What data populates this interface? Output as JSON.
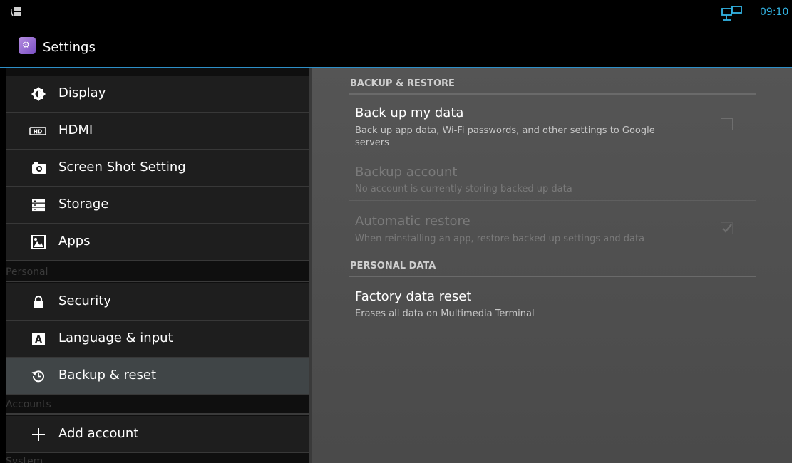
{
  "status_bar": {
    "time": "09:10",
    "left_icon": "call-forward-icon",
    "network_icon": "ethernet-monitor-icon"
  },
  "action_bar": {
    "title": "Settings",
    "icon": "settings-app-icon"
  },
  "sidebar": {
    "items": [
      {
        "label": "Display",
        "icon": "brightness-icon"
      },
      {
        "label": "HDMI",
        "icon": "hdmi-icon",
        "icon_text": "HD"
      },
      {
        "label": "Screen Shot Setting",
        "icon": "camera-icon"
      },
      {
        "label": "Storage",
        "icon": "storage-icon"
      },
      {
        "label": "Apps",
        "icon": "apps-icon"
      },
      {
        "label": "Security",
        "icon": "lock-icon"
      },
      {
        "label": "Language & input",
        "icon": "language-icon",
        "icon_text": "A"
      },
      {
        "label": "Backup & reset",
        "icon": "backup-icon",
        "selected": true
      },
      {
        "label": "Add account",
        "icon": "plus-icon"
      }
    ],
    "headers": [
      "Personal",
      "Accounts",
      "System"
    ]
  },
  "content": {
    "backup_section": "BACKUP & RESTORE",
    "backup_my_data": {
      "title": "Back up my data",
      "summary": "Back up app data, Wi-Fi passwords, and other settings to Google servers",
      "checked": false
    },
    "backup_account": {
      "title": "Backup account",
      "summary": "No account is currently storing backed up data"
    },
    "auto_restore": {
      "title": "Automatic restore",
      "summary": "When reinstalling an app, restore backed up settings and data",
      "checked": true
    },
    "personal_section": "PERSONAL DATA",
    "factory_reset": {
      "title": "Factory data reset",
      "summary": "Erases all data on Multimedia Terminal"
    }
  },
  "colors": {
    "accent": "#33b5e5",
    "selected_row": "#404547",
    "content_bg": "#4f4f4f"
  }
}
